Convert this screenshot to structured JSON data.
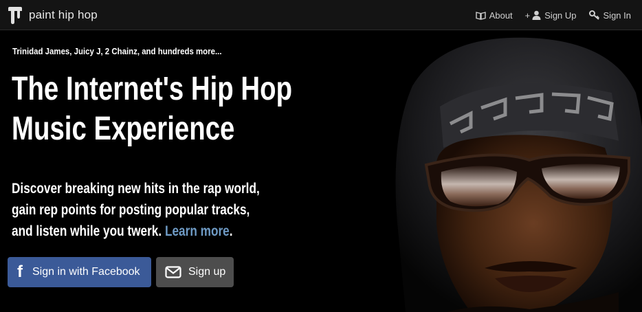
{
  "brand": {
    "name": "paint hip hop",
    "logo_icon": "paint-drip-logo-icon"
  },
  "nav": {
    "about": "About",
    "signup": "Sign Up",
    "signup_prefix": "+",
    "signin": "Sign In",
    "icons": {
      "about": "book-icon",
      "signup": "user-icon",
      "signin": "key-icon"
    }
  },
  "hero": {
    "kicker": "Trinidad James, Juicy J, 2 Chainz, and hundreds more...",
    "headline_line1": "The Internet's Hip Hop",
    "headline_line2": "Music Experience",
    "tagline_line1": "Discover breaking new hits in the rap world,",
    "tagline_line2": "gain rep points for posting popular tracks,",
    "tagline_line3": "and listen while you twerk.",
    "learn_more": "Learn more",
    "period": "."
  },
  "buttons": {
    "facebook": "Sign in with Facebook",
    "signup": "Sign up"
  },
  "colors": {
    "navbar_bg": "#141414",
    "facebook_blue": "#3b5a98",
    "signup_gray": "#4d4d4d",
    "link_blue": "#6e9ac4"
  }
}
